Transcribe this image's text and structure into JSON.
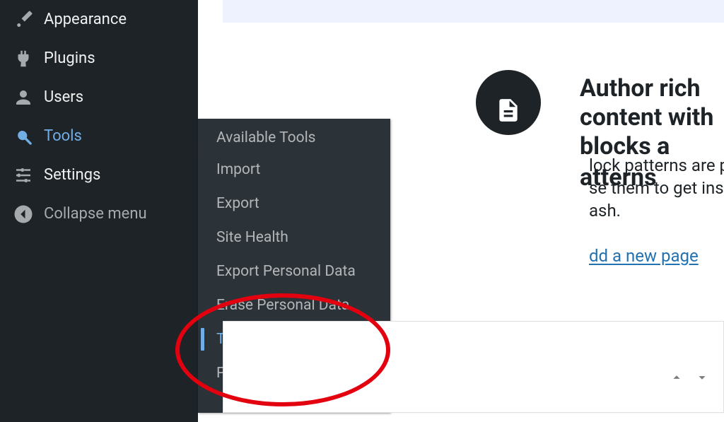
{
  "sidebar": {
    "items": [
      {
        "label": "Appearance"
      },
      {
        "label": "Plugins"
      },
      {
        "label": "Users"
      },
      {
        "label": "Tools"
      },
      {
        "label": "Settings"
      }
    ],
    "collapse_label": "Collapse menu"
  },
  "submenu": {
    "items": [
      {
        "label": "Available Tools"
      },
      {
        "label": "Import"
      },
      {
        "label": "Export"
      },
      {
        "label": "Site Health"
      },
      {
        "label": "Export Personal Data"
      },
      {
        "label": "Erase Personal Data"
      },
      {
        "label": "Theme File Editor"
      },
      {
        "label": "Plugin File Editor"
      }
    ]
  },
  "content": {
    "headline_line1": "Author rich content with blocks a",
    "headline_line2": "atterns",
    "body_line1": "lock patterns are pre-configured block layo",
    "body_line2": "se them to get inspired or create new page",
    "body_line3": "ash.",
    "link_label": "dd a new page"
  }
}
